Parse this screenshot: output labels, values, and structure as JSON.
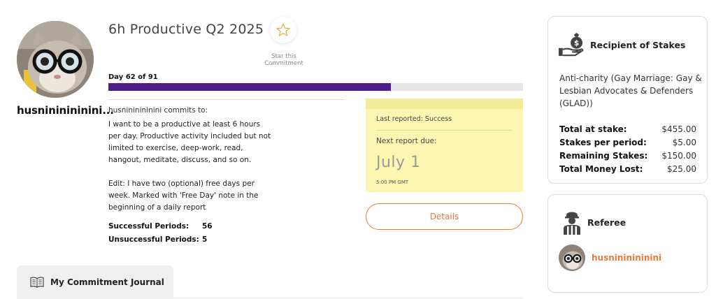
{
  "profile": {
    "username": "husnininininini...",
    "avatar_icon": "cat-with-glasses-avatar"
  },
  "commitment": {
    "title": "6h Productive Q2 2025",
    "star_caption": "Star this Commitment",
    "day_label": "Day 62 of 91",
    "progress_fraction": 0.681,
    "commits_to": "husnininininini commits to:",
    "description": "I want to be a productive at least 6 hours per day. Productive activity included but not limited to exercise, deep-work, read, hangout, meditate, discuss, and so on.\n\nEdit: I have two (optional) free days per week. Marked with 'Free Day' note in the beginning of a daily report",
    "stats": [
      {
        "label": "Successful Periods:",
        "value": "56"
      },
      {
        "label": "Unsuccessful Periods:",
        "value": "5"
      }
    ]
  },
  "report": {
    "last_reported": "Last reported: Success",
    "next_due_label": "Next report due:",
    "due_date": "July 1",
    "due_time": "5:00 PM GMT"
  },
  "details_button": "Details",
  "journal": {
    "tab_label": "My Commitment Journal",
    "icon": "open-book-icon"
  },
  "stakes_card": {
    "title": "Recipient of Stakes",
    "icon": "money-bag-hand-icon",
    "recipient": "Anti-charity (Gay Marriage: Gay & Lesbian Advocates & Defenders (GLAD))",
    "rows": [
      {
        "label": "Total at stake:",
        "value": "$455.00"
      },
      {
        "label": "Stakes per period:",
        "value": "$5.00"
      },
      {
        "label": "Remaining Stakes:",
        "value": "$150.00"
      },
      {
        "label": "Total Money Lost:",
        "value": "$25.00"
      }
    ]
  },
  "referee_card": {
    "title": "Referee",
    "icon": "referee-icon",
    "name": "husnininininini"
  },
  "colors": {
    "accent": "#e8793a",
    "progress": "#4d1b8a",
    "report_bg": "#fbf6b2"
  }
}
